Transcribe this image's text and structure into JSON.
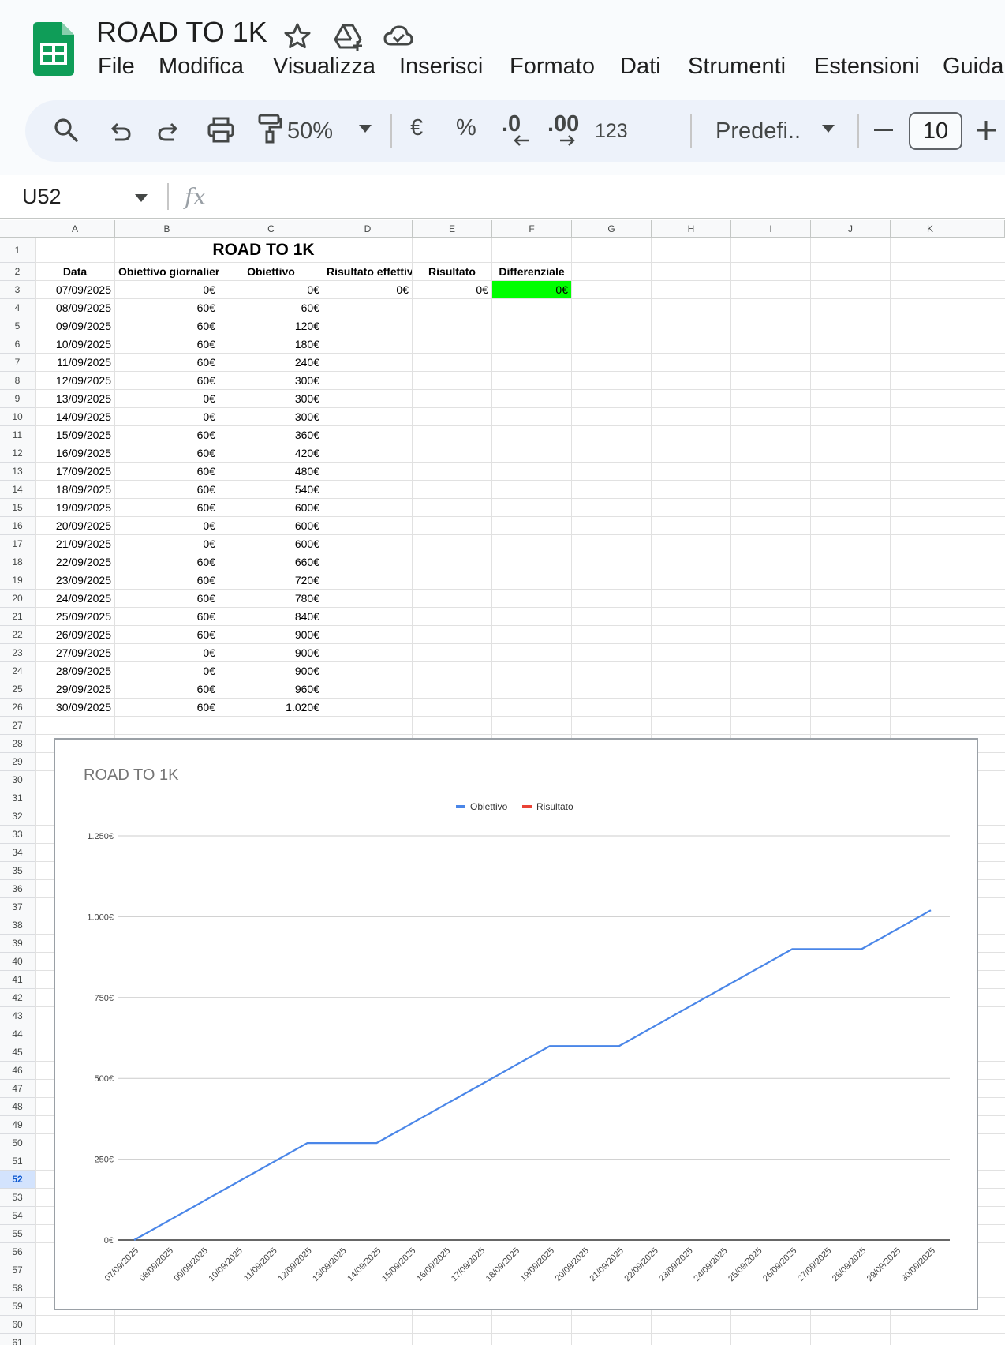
{
  "app": {
    "title": "ROAD TO 1K",
    "menu": [
      "File",
      "Modifica",
      "Visualizza",
      "Inserisci",
      "Formato",
      "Dati",
      "Strumenti",
      "Estensioni",
      "Guida"
    ]
  },
  "toolbar": {
    "zoom": "50%",
    "currency_label": "€",
    "percent_label": "%",
    "dec_decrease_label": ".0",
    "dec_increase_label": ".00",
    "number_format_label": "123",
    "font_label": "Predefi..",
    "font_size": "10",
    "icons": [
      "search-icon",
      "undo-icon",
      "redo-icon",
      "print-icon",
      "paint-format-icon",
      "chevron-down-icon",
      "minus-icon",
      "plus-icon"
    ]
  },
  "formula_bar": {
    "name_box": "U52",
    "fx_label": "fx"
  },
  "grid": {
    "columns": [
      "A",
      "B",
      "C",
      "D",
      "E",
      "F",
      "G",
      "H",
      "I",
      "J",
      "K"
    ],
    "row_count": 64,
    "selected_row": 52,
    "title": "ROAD TO 1K",
    "headers": [
      "Data",
      "Obiettivo giornaliero",
      "Obiettivo",
      "Risultato effettivo",
      "Risultato",
      "Differenziale"
    ],
    "first_row": {
      "data": "07/09/2025",
      "giornaliero": "0€",
      "obiettivo": "0€",
      "risultato_effettivo": "0€",
      "risultato": "0€",
      "differenziale": "0€"
    },
    "rows": [
      [
        "08/09/2025",
        "60€",
        "60€"
      ],
      [
        "09/09/2025",
        "60€",
        "120€"
      ],
      [
        "10/09/2025",
        "60€",
        "180€"
      ],
      [
        "11/09/2025",
        "60€",
        "240€"
      ],
      [
        "12/09/2025",
        "60€",
        "300€"
      ],
      [
        "13/09/2025",
        "0€",
        "300€"
      ],
      [
        "14/09/2025",
        "0€",
        "300€"
      ],
      [
        "15/09/2025",
        "60€",
        "360€"
      ],
      [
        "16/09/2025",
        "60€",
        "420€"
      ],
      [
        "17/09/2025",
        "60€",
        "480€"
      ],
      [
        "18/09/2025",
        "60€",
        "540€"
      ],
      [
        "19/09/2025",
        "60€",
        "600€"
      ],
      [
        "20/09/2025",
        "0€",
        "600€"
      ],
      [
        "21/09/2025",
        "0€",
        "600€"
      ],
      [
        "22/09/2025",
        "60€",
        "660€"
      ],
      [
        "23/09/2025",
        "60€",
        "720€"
      ],
      [
        "24/09/2025",
        "60€",
        "780€"
      ],
      [
        "25/09/2025",
        "60€",
        "840€"
      ],
      [
        "26/09/2025",
        "60€",
        "900€"
      ],
      [
        "27/09/2025",
        "0€",
        "900€"
      ],
      [
        "28/09/2025",
        "0€",
        "900€"
      ],
      [
        "29/09/2025",
        "60€",
        "960€"
      ],
      [
        "30/09/2025",
        "60€",
        "1.020€"
      ]
    ],
    "differenziale_color": "#00ff00"
  },
  "chart_data": {
    "type": "line",
    "title": "ROAD TO 1K",
    "legend_position": "top",
    "grid": true,
    "ylim": [
      0,
      1250
    ],
    "y_ticks": [
      "0€",
      "250€",
      "500€",
      "750€",
      "1.000€",
      "1.250€"
    ],
    "y_tick_values": [
      0,
      250,
      500,
      750,
      1000,
      1250
    ],
    "categories": [
      "07/09/2025",
      "08/09/2025",
      "09/09/2025",
      "10/09/2025",
      "11/09/2025",
      "12/09/2025",
      "13/09/2025",
      "14/09/2025",
      "15/09/2025",
      "16/09/2025",
      "17/09/2025",
      "18/09/2025",
      "19/09/2025",
      "20/09/2025",
      "21/09/2025",
      "22/09/2025",
      "23/09/2025",
      "24/09/2025",
      "25/09/2025",
      "26/09/2025",
      "27/09/2025",
      "28/09/2025",
      "29/09/2025",
      "30/09/2025"
    ],
    "series": [
      {
        "name": "Obiettivo",
        "color": "#4a86e8",
        "values": [
          0,
          60,
          120,
          180,
          240,
          300,
          300,
          300,
          360,
          420,
          480,
          540,
          600,
          600,
          600,
          660,
          720,
          780,
          840,
          900,
          900,
          900,
          960,
          1020
        ]
      },
      {
        "name": "Risultato",
        "color": "#ea4335",
        "values": []
      }
    ]
  }
}
